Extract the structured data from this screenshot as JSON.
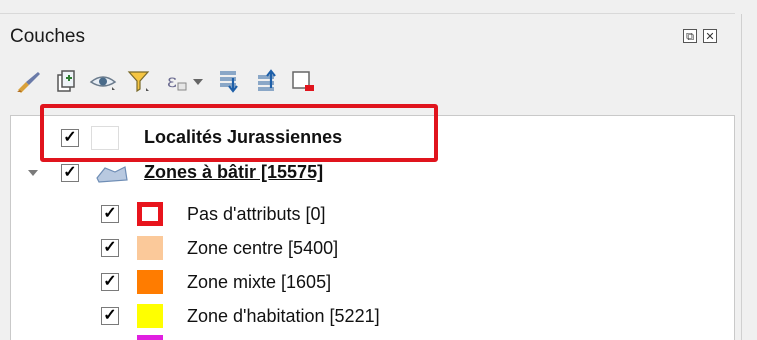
{
  "panel": {
    "title": "Couches"
  },
  "layers": [
    {
      "label": "Localités Jurassiennes",
      "checked": "✓"
    },
    {
      "label": "Zones à bâtir [15575]",
      "checked": "✓"
    }
  ],
  "legend": [
    {
      "label": "Pas d'attributs [0]",
      "checked": "✓",
      "color": "#e8141c"
    },
    {
      "label": "Zone centre [5400]",
      "checked": "✓",
      "color": "#fbc99a"
    },
    {
      "label": "Zone mixte [1605]",
      "checked": "✓",
      "color": "#ff7c00"
    },
    {
      "label": "Zone d'habitation [5221]",
      "checked": "✓",
      "color": "#ffff00"
    }
  ],
  "toolbar": {
    "icons": [
      "style-brush-icon",
      "add-group-icon",
      "visibility-eye-icon",
      "filter-legend-icon",
      "expression-filter-icon",
      "expand-all-icon",
      "collapse-all-icon",
      "remove-layer-icon"
    ]
  }
}
